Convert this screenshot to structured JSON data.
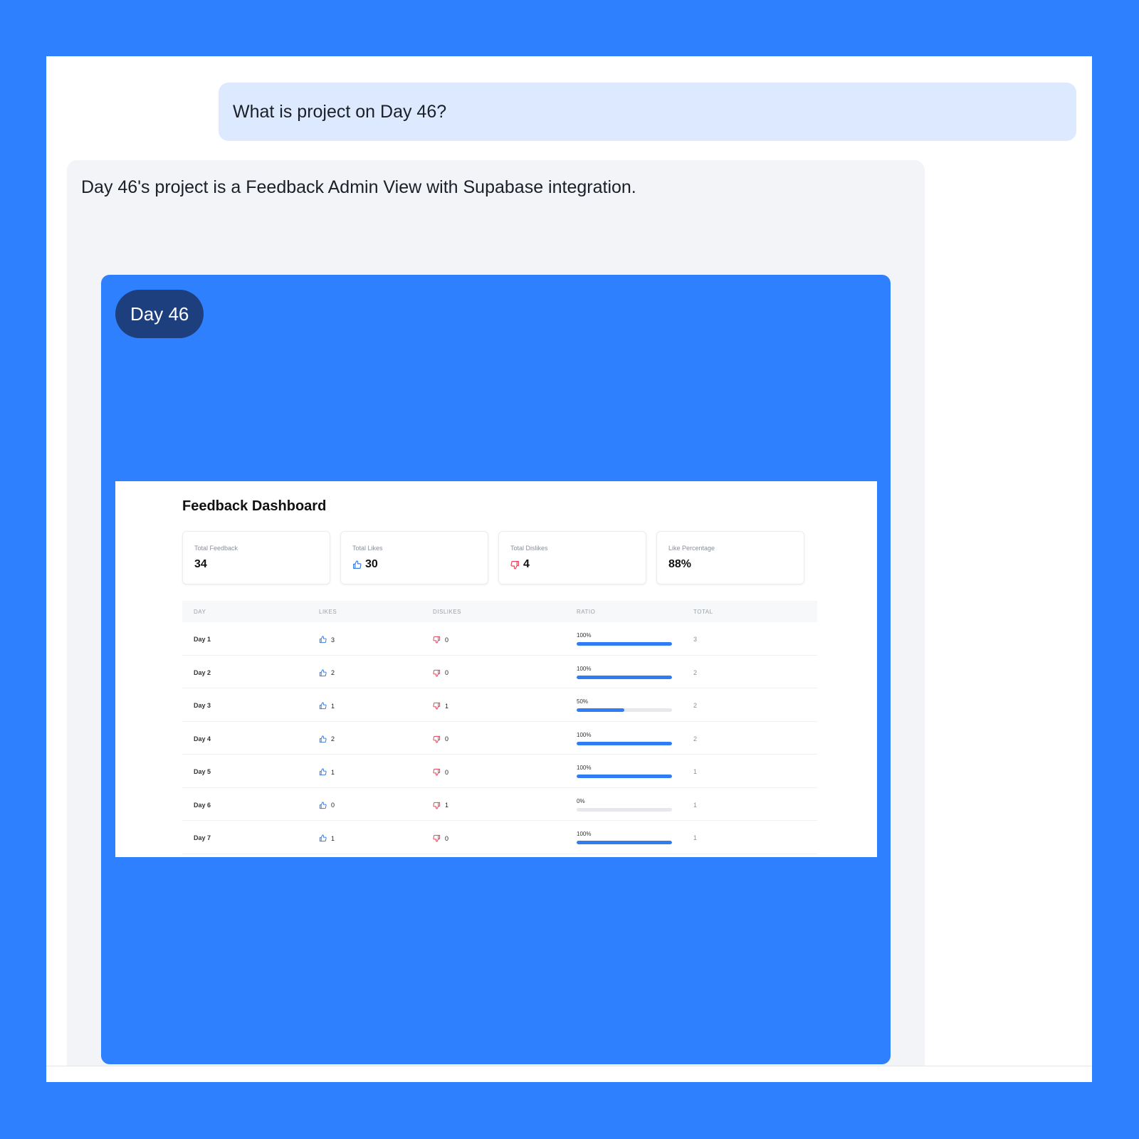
{
  "conversation": {
    "user_message": "What is project on Day 46?",
    "assistant_message": "Day 46's project is a Feedback Admin View with Supabase integration."
  },
  "project_card": {
    "day_badge": "Day 46",
    "background_color": "#2f80ff"
  },
  "dashboard": {
    "title": "Feedback Dashboard",
    "stats": [
      {
        "label": "Total Feedback",
        "value": "34",
        "icon": ""
      },
      {
        "label": "Total Likes",
        "value": "30",
        "icon": "thumbs-up-icon"
      },
      {
        "label": "Total Dislikes",
        "value": "4",
        "icon": "thumbs-down-icon"
      },
      {
        "label": "Like Percentage",
        "value": "88%",
        "icon": ""
      }
    ],
    "columns": [
      "DAY",
      "LIKES",
      "DISLIKES",
      "RATIO",
      "TOTAL"
    ],
    "rows": [
      {
        "day": "Day 1",
        "likes": "3",
        "dislikes": "0",
        "ratio_label": "100%",
        "ratio": 1.0,
        "total": "3"
      },
      {
        "day": "Day 2",
        "likes": "2",
        "dislikes": "0",
        "ratio_label": "100%",
        "ratio": 1.0,
        "total": "2"
      },
      {
        "day": "Day 3",
        "likes": "1",
        "dislikes": "1",
        "ratio_label": "50%",
        "ratio": 0.5,
        "total": "2"
      },
      {
        "day": "Day 4",
        "likes": "2",
        "dislikes": "0",
        "ratio_label": "100%",
        "ratio": 1.0,
        "total": "2"
      },
      {
        "day": "Day 5",
        "likes": "1",
        "dislikes": "0",
        "ratio_label": "100%",
        "ratio": 1.0,
        "total": "1"
      },
      {
        "day": "Day 6",
        "likes": "0",
        "dislikes": "1",
        "ratio_label": "0%",
        "ratio": 0.0,
        "total": "1"
      },
      {
        "day": "Day 7",
        "likes": "1",
        "dislikes": "0",
        "ratio_label": "100%",
        "ratio": 1.0,
        "total": "1"
      }
    ],
    "colors": {
      "like": "#3b7ddd",
      "dislike": "#e0455a",
      "ratio_bar": "#2f7cf3"
    }
  }
}
